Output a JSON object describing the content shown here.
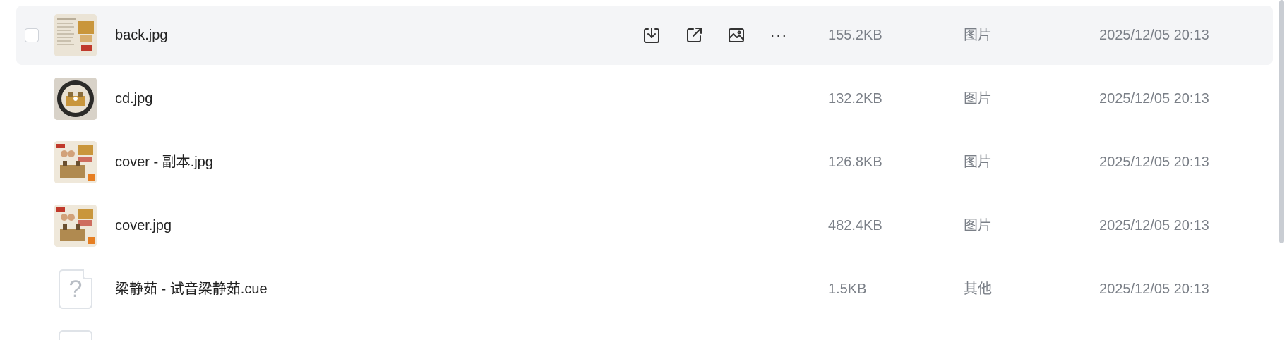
{
  "files": [
    {
      "name": "back.jpg",
      "size": "155.2KB",
      "type": "图片",
      "date": "2025/12/05 20:13",
      "thumb": "album-back-thumbnail",
      "hovered": true
    },
    {
      "name": "cd.jpg",
      "size": "132.2KB",
      "type": "图片",
      "date": "2025/12/05 20:13",
      "thumb": "cd-disc-thumbnail",
      "hovered": false
    },
    {
      "name": "cover - 副本.jpg",
      "size": "126.8KB",
      "type": "图片",
      "date": "2025/12/05 20:13",
      "thumb": "album-cover-thumbnail",
      "hovered": false
    },
    {
      "name": "cover.jpg",
      "size": "482.4KB",
      "type": "图片",
      "date": "2025/12/05 20:13",
      "thumb": "album-cover-thumbnail",
      "hovered": false
    },
    {
      "name": "梁静茹 - 试音梁静茹.cue",
      "size": "1.5KB",
      "type": "其他",
      "date": "2025/12/05 20:13",
      "thumb": "unknown-file-icon",
      "icon_glyph": "?",
      "hovered": false
    }
  ],
  "row_actions": [
    "download-icon",
    "share-icon",
    "image-preview-icon",
    "more-icon"
  ],
  "more_glyph": "···",
  "colors": {
    "hover_bg": "#f4f5f7",
    "primary_text": "#222222",
    "secondary_text": "#7a7f87",
    "scrollbar": "#c9cdd3"
  }
}
